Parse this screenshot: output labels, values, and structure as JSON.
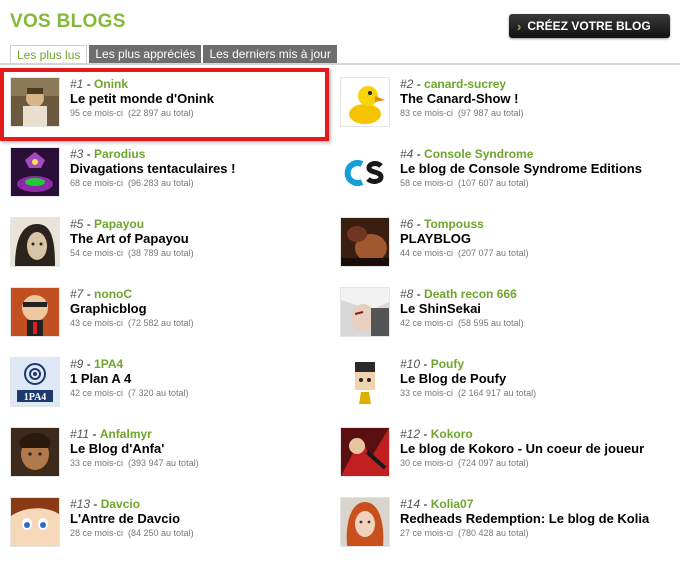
{
  "header": {
    "title": "VOS BLOGS",
    "create_label": "CRÉEZ VOTRE BLOG"
  },
  "tabs": [
    {
      "label": "Les plus lus",
      "active": true
    },
    {
      "label": "Les plus appréciés",
      "active": false
    },
    {
      "label": "Les derniers mis à jour",
      "active": false
    }
  ],
  "colors": {
    "accent": "#86b83a",
    "highlight": "#e51b1b"
  },
  "blogs": [
    {
      "rank": "#1",
      "author": "Onink",
      "title": "Le petit monde d'Onink",
      "month": "95 ce mois-ci",
      "total": "(22 897 au total)",
      "thumb": "portrait-photo"
    },
    {
      "rank": "#2",
      "author": "canard-sucrey",
      "title": "The Canard-Show !",
      "month": "83 ce mois-ci",
      "total": "(97 987 au total)",
      "thumb": "yellow-duck"
    },
    {
      "rank": "#3",
      "author": "Parodius",
      "title": "Divagations tentaculaires !",
      "month": "68 ce mois-ci",
      "total": "(96 283 au total)",
      "thumb": "tentacle-game"
    },
    {
      "rank": "#4",
      "author": "Console Syndrome",
      "title": "Le blog de Console Syndrome Editions",
      "month": "58 ce mois-ci",
      "total": "(107 607 au total)",
      "thumb": "cs-logo"
    },
    {
      "rank": "#5",
      "author": "Papayou",
      "title": "The Art of Papayou",
      "month": "54 ce mois-ci",
      "total": "(38 789 au total)",
      "thumb": "drawn-face"
    },
    {
      "rank": "#6",
      "author": "Tompouss",
      "title": "PLAYBLOG",
      "month": "44 ce mois-ci",
      "total": "(207 077 au total)",
      "thumb": "photo"
    },
    {
      "rank": "#7",
      "author": "nonoC",
      "title": "Graphicblog",
      "month": "43 ce mois-ci",
      "total": "(72 582 au total)",
      "thumb": "cartoon-head"
    },
    {
      "rank": "#8",
      "author": "Death recon 666",
      "title": "Le ShinSekai",
      "month": "42 ce mois-ci",
      "total": "(58 595 au total)",
      "thumb": "anime-face"
    },
    {
      "rank": "#9",
      "author": "1PA4",
      "title": "1 Plan A 4",
      "month": "42 ce mois-ci",
      "total": "(7 320 au total)",
      "thumb": "1pa4-logo"
    },
    {
      "rank": "#10",
      "author": "Poufy",
      "title": "Le Blog de Poufy",
      "month": "33 ce mois-ci",
      "total": "(2 164 917 au total)",
      "thumb": "cartoon-man"
    },
    {
      "rank": "#11",
      "author": "Anfalmyr",
      "title": "Le Blog d'Anfa'",
      "month": "33 ce mois-ci",
      "total": "(393 947 au total)",
      "thumb": "painted-face"
    },
    {
      "rank": "#12",
      "author": "Kokoro",
      "title": "Le blog de Kokoro - Un coeur de joueur",
      "month": "30 ce mois-ci",
      "total": "(724 097 au total)",
      "thumb": "comic-art"
    },
    {
      "rank": "#13",
      "author": "Davcio",
      "title": "L'Antre de Davcio",
      "month": "28 ce mois-ci",
      "total": "(84 250 au total)",
      "thumb": "manga-face"
    },
    {
      "rank": "#14",
      "author": "Kolia07",
      "title": "Redheads Redemption: Le blog de Kolia",
      "month": "27 ce mois-ci",
      "total": "(780 428 au total)",
      "thumb": "redhead-photo"
    }
  ]
}
